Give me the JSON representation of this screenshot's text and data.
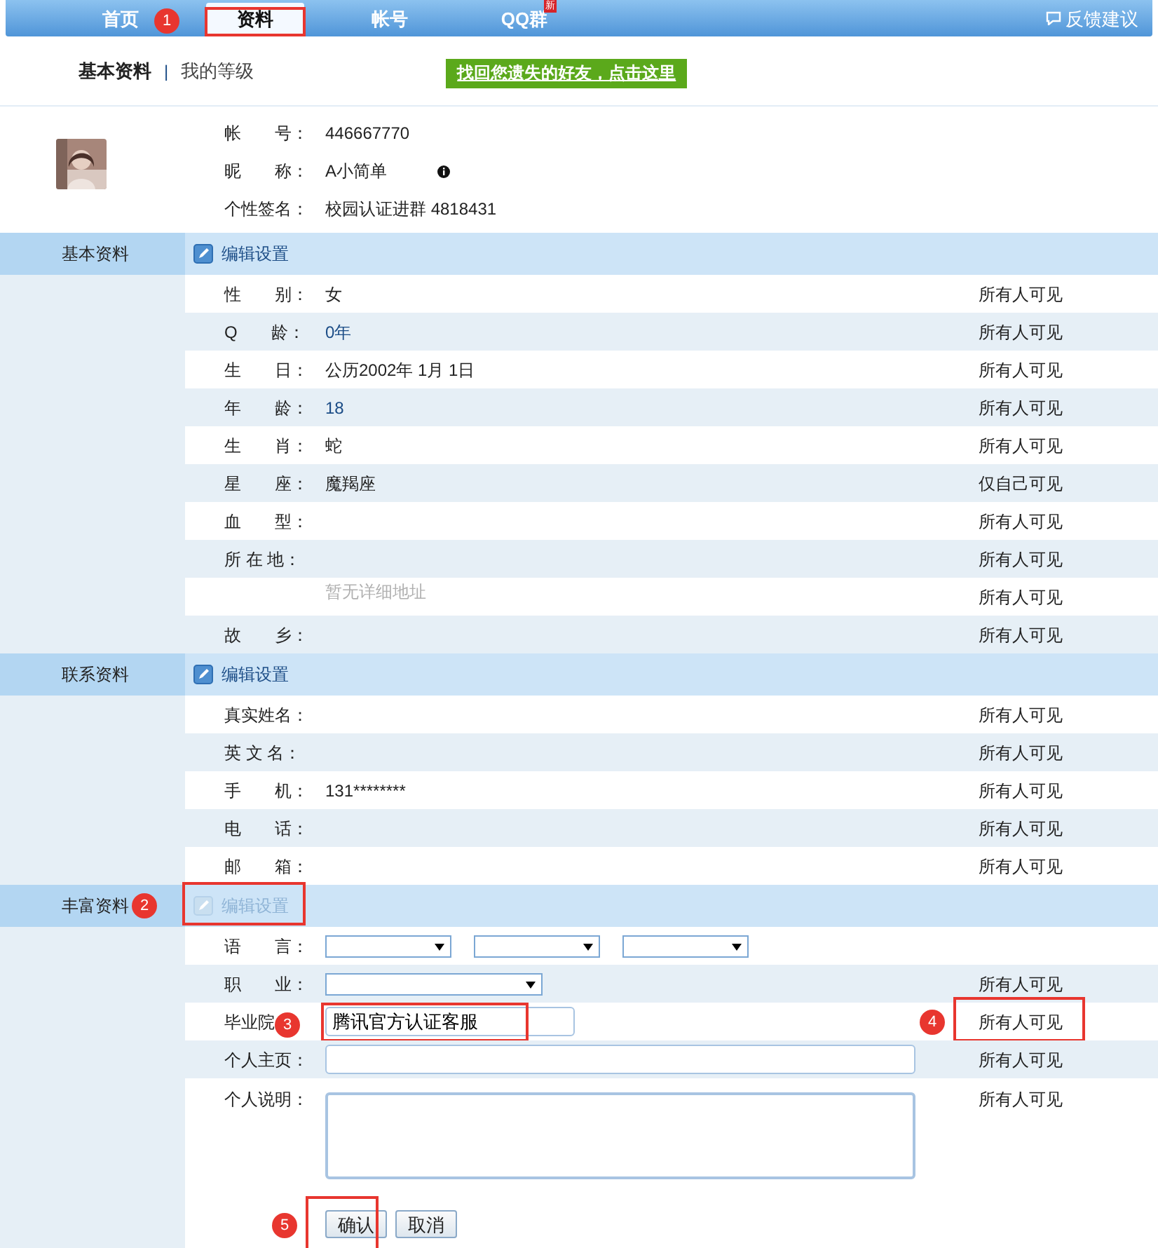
{
  "nav": {
    "tabs": [
      {
        "label": "首页",
        "selected": false
      },
      {
        "label": "资料",
        "selected": true,
        "highlighted": true,
        "annotation": "1"
      },
      {
        "label": "帐号",
        "selected": false
      },
      {
        "label": "QQ群",
        "selected": false,
        "badge": "新"
      }
    ],
    "feedback": "反馈建议"
  },
  "subnav": {
    "items": [
      {
        "label": "基本资料",
        "selected": true
      },
      {
        "label": "我的等级",
        "selected": false
      }
    ],
    "separator": "|",
    "banner": "找回您遗失的好友，点击这里"
  },
  "profile": {
    "fields": [
      {
        "label": "帐　　号：",
        "value": "446667770"
      },
      {
        "label": "昵　　称：",
        "value": "A小简单",
        "info": true
      },
      {
        "label": "个性签名：",
        "value": "校园认证进群 4818431"
      }
    ]
  },
  "sections": [
    {
      "title": "基本资料",
      "edit_label": "编辑设置",
      "edit_disabled": false,
      "rows": [
        {
          "kind": "text",
          "label": "性　　别：",
          "value": "女",
          "visibility": "所有人可见"
        },
        {
          "kind": "number",
          "label": "Q　　龄：",
          "value": "0年",
          "visibility": "所有人可见"
        },
        {
          "kind": "text",
          "label": "生　　日：",
          "value": "公历2002年 1月 1日",
          "visibility": "所有人可见"
        },
        {
          "kind": "number",
          "label": "年　　龄：",
          "value": "18",
          "visibility": "所有人可见"
        },
        {
          "kind": "text",
          "label": "生　　肖：",
          "value": "蛇",
          "visibility": "所有人可见"
        },
        {
          "kind": "text",
          "label": "星　　座：",
          "value": "魔羯座",
          "visibility": "仅自己可见"
        },
        {
          "kind": "text",
          "label": "血　　型：",
          "visibility": "所有人可见"
        },
        {
          "kind": "text",
          "label": "所 在 地：",
          "visibility": "所有人可见"
        },
        {
          "kind": "note",
          "value": "暂无详细地址",
          "visibility": "所有人可见"
        },
        {
          "kind": "text",
          "label": "故　　乡：",
          "visibility": "所有人可见"
        }
      ]
    },
    {
      "title": "联系资料",
      "edit_label": "编辑设置",
      "edit_disabled": false,
      "rows": [
        {
          "kind": "text",
          "label": "真实姓名：",
          "visibility": "所有人可见"
        },
        {
          "kind": "text",
          "label": "英 文 名：",
          "visibility": "所有人可见"
        },
        {
          "kind": "text",
          "label": "手　　机：",
          "value": "131********",
          "visibility": "所有人可见"
        },
        {
          "kind": "text",
          "label": "电　　话：",
          "visibility": "所有人可见"
        },
        {
          "kind": "text",
          "label": "邮　　箱：",
          "visibility": "所有人可见"
        }
      ]
    },
    {
      "title": "丰富资料",
      "annotation": "2",
      "edit_label": "编辑设置",
      "edit_disabled": true,
      "highlighted": true,
      "rows": [
        {
          "kind": "language",
          "label": "语　　言："
        },
        {
          "kind": "select",
          "label": "职　　业：",
          "visibility": "所有人可见"
        },
        {
          "kind": "input",
          "label": "毕业院",
          "value": "腾讯官方认证客服",
          "highlighted": true,
          "annotation": "3",
          "visibility": "所有人可见",
          "visibility_highlighted": true,
          "visibility_annotation": "4"
        },
        {
          "kind": "wide-input",
          "label": "个人主页：",
          "visibility": "所有人可见"
        },
        {
          "kind": "textarea",
          "label": "个人说明：",
          "visibility": "所有人可见"
        }
      ],
      "buttons": [
        {
          "label": "确认",
          "highlighted": true,
          "annotation": "5"
        },
        {
          "label": "取消"
        }
      ]
    }
  ]
}
